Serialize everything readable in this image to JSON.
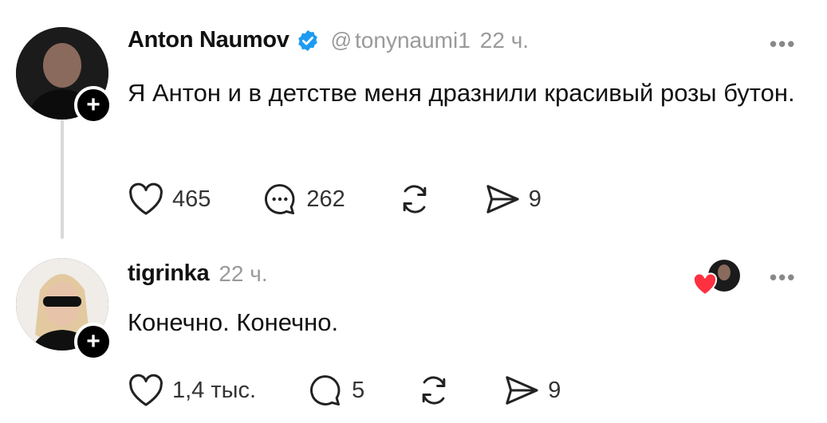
{
  "posts": [
    {
      "username": "Anton Naumov",
      "verified": true,
      "handle_icon": "threads-icon",
      "handle": "tonynaumi1",
      "timestamp": "22 ч.",
      "text": "Я Антон и в детстве меня дразнили красивый розы бутон.",
      "likes": "465",
      "replies": "262",
      "shares": "9"
    },
    {
      "username": "tigrinka",
      "timestamp": "22 ч.",
      "text": "Конечно. Конечно.",
      "likes": "1,4 тыс.",
      "replies": "5",
      "shares": "9"
    }
  ],
  "more_label": "•••",
  "follow_label": "+",
  "colors": {
    "verified": "#1d9bf0",
    "heart": "#ff3040",
    "secondary_text": "#9a9a9a"
  }
}
